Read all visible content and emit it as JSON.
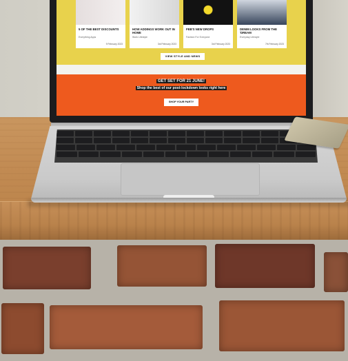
{
  "screen": {
    "products": [
      {
        "title": "5 OF THE BEST DISCOUNTS",
        "subtitle": "Everything Apps",
        "date": "9 February 2023"
      },
      {
        "title": "HOW ADDINGS WORK OUT IN HOME",
        "subtitle": "Work Lifestyle",
        "date": "3rd February 2023"
      },
      {
        "title": "FEB'S NEW DROPS",
        "subtitle": "Fashion For Everyone",
        "date": "3rd February 2023"
      },
      {
        "title": "DENIM LOOKS FROM THE 'DREAM",
        "subtitle": "Everyday Lifestyle",
        "date": "7th February 2023"
      }
    ],
    "view_button": "VIEW STYLE AND NEWS",
    "promo_title": "GET SET FOR 21 JUNE!",
    "promo_subtitle": "Shop the best of our post-lockdown looks right here",
    "shop_button": "SHOP YOUR PARTY"
  },
  "colors": {
    "screen_yellow": "#e8d24c",
    "screen_orange": "#ee5a1e",
    "wood": "#c18a52",
    "brick": "#8d4b2f"
  }
}
